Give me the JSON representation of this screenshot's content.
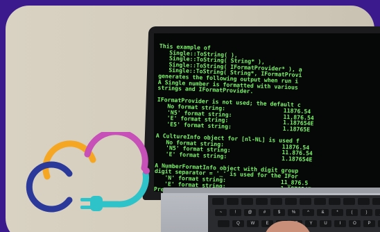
{
  "terminal": {
    "lines": [
      "This example of",
      "   Single::ToString( ),",
      "   Single::ToString( String* ),",
      "   Single::ToString( IFormatProvider* ), a",
      "   Single::ToString( String*, IFormatProvi",
      "generates the following output when run i",
      "A Single number is formatted with various",
      "strings and IFormatProvider.",
      "",
      "IFormatProvider is not used; the default c",
      "   No format string:                 11876.54",
      "   'N5' format string:               11,876.54",
      "   'E' format string:                1.187654E",
      "   'E5' format string:               1.18765E",
      "",
      "A CultureInfo object for [nl-NL] is used f",
      "   No format string:                 11876.54",
      "   'N5' format string:               11.876.54",
      "   'E' format string:                1.187654E",
      "",
      "A NumberFormatInfo object with digit group",
      "digit separator = '_' is used for the IFor",
      "   'N' format string:                11_876.5",
      "   'E' format string:                1.187654E",
      "Press any key to continue . . ."
    ]
  },
  "keyboard": {
    "row1": [
      "",
      "",
      "",
      "",
      "",
      "",
      "",
      "",
      "",
      "",
      "",
      ""
    ],
    "row2": [
      "~",
      "!",
      "@",
      "#",
      "$",
      "%",
      "^",
      "&",
      "*",
      "(",
      ")",
      "_"
    ],
    "row3": [
      "",
      "Q",
      "W",
      "E",
      "R",
      "T",
      "Y",
      "U",
      "I",
      "O",
      "P",
      "{"
    ]
  },
  "colors": {
    "background": "#3a1a8c",
    "terminal_text": "#7cf26b",
    "logo_orange": "#f5a623",
    "logo_pink": "#c64fb8",
    "logo_navy": "#2b3a9a",
    "logo_teal": "#2ec3c9"
  }
}
